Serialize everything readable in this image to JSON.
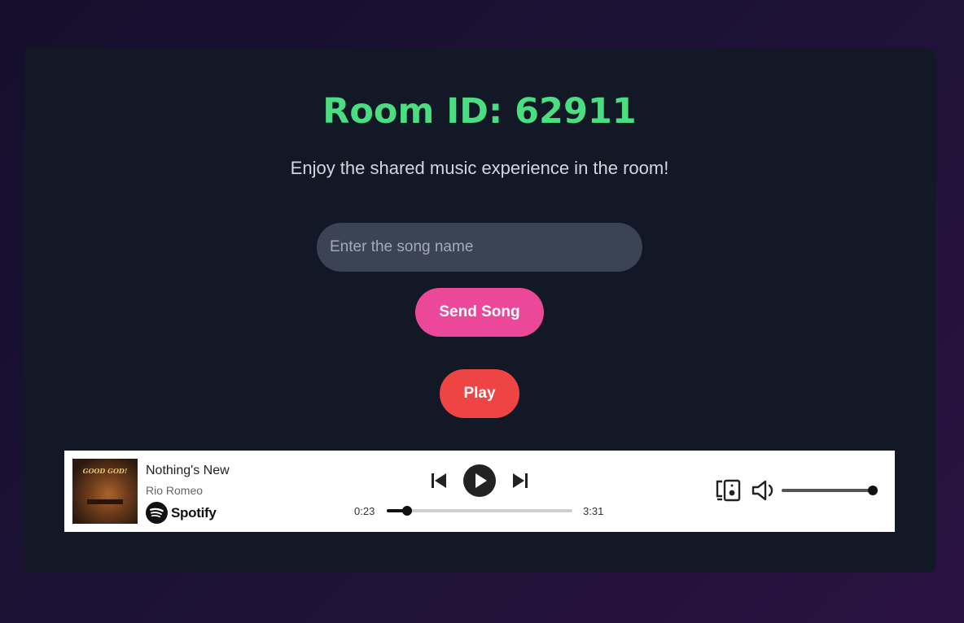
{
  "room": {
    "title": "Room ID: 62911",
    "subtitle": "Enjoy the shared music experience in the room!"
  },
  "song_input": {
    "placeholder": "Enter the song name",
    "value": ""
  },
  "buttons": {
    "send_label": "Send Song",
    "play_label": "Play"
  },
  "player": {
    "album_art_text": "GOOD GOD!",
    "track": "Nothing's New",
    "artist": "Rio Romeo",
    "brand": "Spotify",
    "elapsed": "0:23",
    "duration": "3:31",
    "progress_fraction": 0.11,
    "volume_fraction": 1.0,
    "icons": [
      "previous-icon",
      "play-icon",
      "next-icon",
      "connect-device-icon",
      "volume-icon",
      "spotify-logo-icon"
    ]
  },
  "colors": {
    "title_green": "#4ade80",
    "send_pink": "#ec4899",
    "play_red": "#ef4444",
    "card_bg": "#131827"
  }
}
